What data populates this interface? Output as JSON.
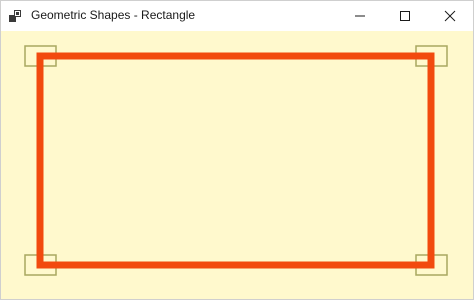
{
  "window": {
    "title": "Geometric Shapes - Rectangle",
    "icons": {
      "app": "app-icon",
      "minimize": "minimize-icon",
      "maximize": "maximize-icon",
      "close": "close-icon"
    }
  },
  "canvas": {
    "background_color": "#fff9cd",
    "shape": {
      "type": "rectangle",
      "stroke_color": "#f24a0e",
      "selected": true
    },
    "handle_color": "#a8a860"
  }
}
